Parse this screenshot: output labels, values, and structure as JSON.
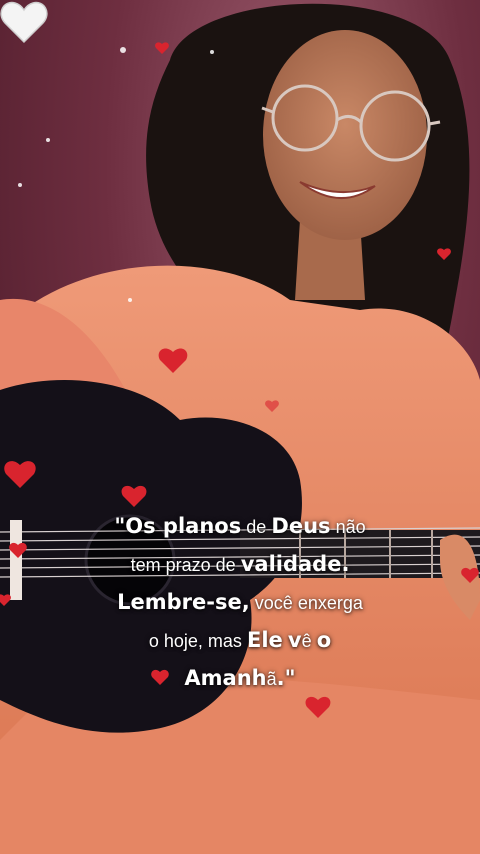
{
  "quote": {
    "line1": {
      "a": "\"Os planos",
      "b": "de",
      "c": "Deus",
      "d": "não"
    },
    "line2": {
      "a": "tem prazo de",
      "b": "validade."
    },
    "line3": {
      "a": "Lembre-se,",
      "b": "você enxerga"
    },
    "line4": {
      "a": "o hoje, mas",
      "b": "Ele",
      "c": "v",
      "d": "ê",
      "e": "o"
    },
    "line5": {
      "a": "Amanh",
      "b": "ã",
      "c": ".\""
    }
  },
  "icons": [
    "heart-icon",
    "white-heart-icon"
  ],
  "colors": {
    "outfit": "#e98b6a",
    "guitar": "#141018",
    "heart": "#d9242e",
    "white_heart": "#f4f4f4",
    "background": "#7a3346"
  }
}
